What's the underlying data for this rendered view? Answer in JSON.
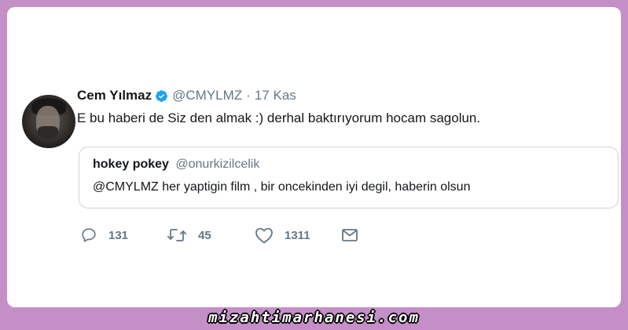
{
  "tweet": {
    "author_name": "Cem Yılmaz",
    "author_handle": "@CMYLMZ",
    "separator": "·",
    "date": "17 Kas",
    "text": "E bu haberi de Siz den almak :) derhal baktırıyorum hocam sagolun.",
    "verified": true,
    "verified_color": "#1da1f2"
  },
  "quoted_tweet": {
    "author_name": "hokey pokey",
    "author_handle": "@onurkizilcelik",
    "text": "@CMYLMZ her yaptigin film , bir oncekinden iyi degil, haberin olsun"
  },
  "actions": {
    "reply_count": "131",
    "retweet_count": "45",
    "like_count": "1311",
    "icons": [
      "reply-icon",
      "retweet-icon",
      "like-icon",
      "message-icon"
    ]
  },
  "watermark": {
    "text": "mizahtimarhanesi.com"
  },
  "colors": {
    "frame": "#c48fc6",
    "card": "#ffffff",
    "text_primary": "#14171a",
    "text_secondary": "#657786",
    "border": "#ccd6dd"
  }
}
